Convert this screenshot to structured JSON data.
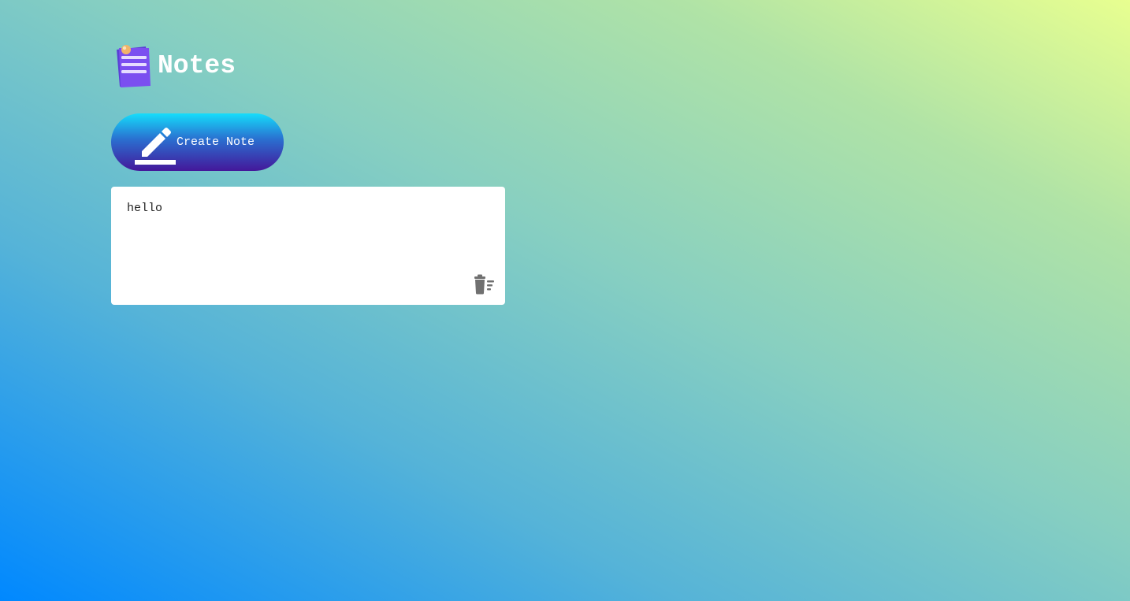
{
  "app": {
    "title": "Notes",
    "logo_icon": "notepad-icon"
  },
  "toolbar": {
    "create_label": "Create Note",
    "create_icon": "pencil-edit-icon"
  },
  "notes": [
    {
      "text": "hello",
      "delete_icon": "trash-sweep-icon"
    }
  ],
  "colors": {
    "background_gradient": [
      "#0088ff",
      "#e8ff90"
    ],
    "button_gradient": [
      "#15ddfb",
      "#44179a"
    ],
    "logo_accent": "#7b4ff0",
    "icon_gray": "#707070"
  }
}
